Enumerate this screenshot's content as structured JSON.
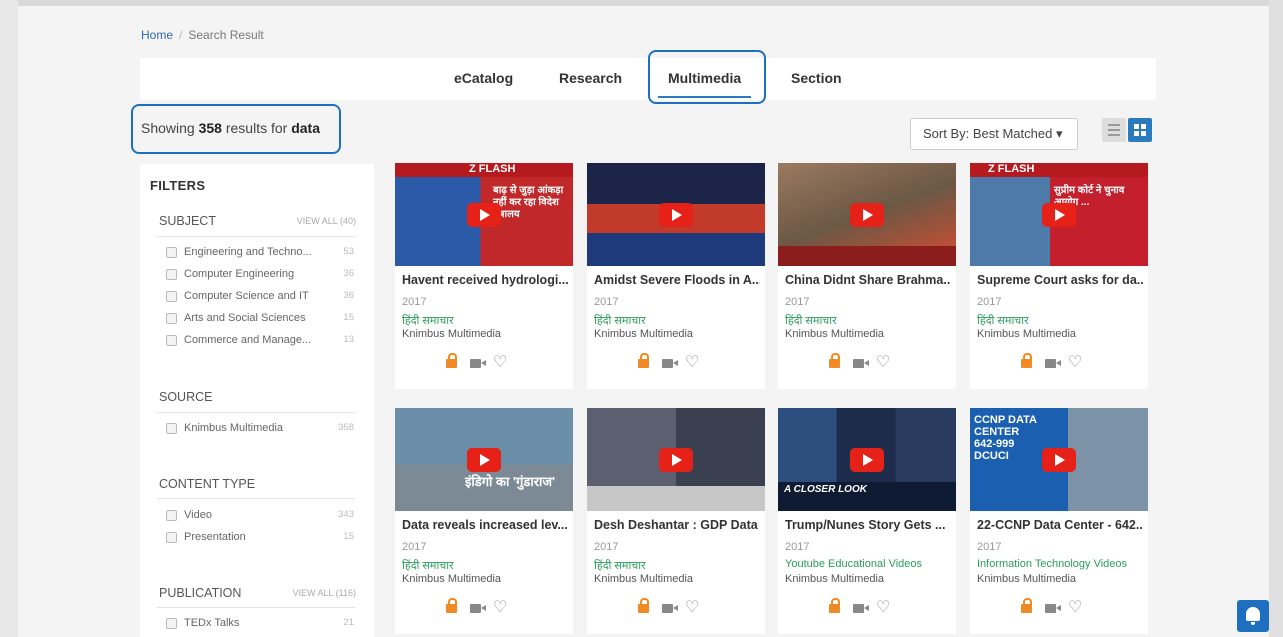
{
  "breadcrumb": {
    "home": "Home",
    "current": "Search Result",
    "separator": "/"
  },
  "tabs": [
    {
      "label": "eCatalog"
    },
    {
      "label": "Research"
    },
    {
      "label": "Multimedia",
      "active": true
    },
    {
      "label": "Section"
    }
  ],
  "results": {
    "prefix": "Showing",
    "count": "358",
    "middle": "results for",
    "query": "data"
  },
  "sort": {
    "label": "Sort By: Best Matched",
    "caret": "▾"
  },
  "filters": {
    "title": "FILTERS",
    "subject": {
      "title": "SUBJECT",
      "view_all": "VIEW ALL (40)",
      "items": [
        {
          "label": "Engineering and Techno...",
          "count": "53"
        },
        {
          "label": "Computer Engineering",
          "count": "36"
        },
        {
          "label": "Computer Science and IT",
          "count": "36"
        },
        {
          "label": "Arts and Social Sciences",
          "count": "15"
        },
        {
          "label": "Commerce and Manage...",
          "count": "13"
        }
      ]
    },
    "source": {
      "title": "SOURCE",
      "items": [
        {
          "label": "Knimbus Multimedia",
          "count": "358"
        }
      ]
    },
    "content_type": {
      "title": "CONTENT TYPE",
      "items": [
        {
          "label": "Video",
          "count": "343"
        },
        {
          "label": "Presentation",
          "count": "15"
        }
      ]
    },
    "publication": {
      "title": "PUBLICATION",
      "view_all": "VIEW ALL (116)",
      "items": [
        {
          "label": "TEDx Talks",
          "count": "21"
        }
      ]
    }
  },
  "cards": [
    {
      "title": "Havent received hydrologi...",
      "year": "2017",
      "category": "हिंदी समाचार",
      "publisher": "Knimbus Multimedia",
      "thumb_text": "बाढ़ से जुड़ा आंकड़ा नहीं कर रहा विदेश मंत्रालय",
      "thumb_badge": "Z FLASH"
    },
    {
      "title": "Amidst Severe Floods in A...",
      "year": "2017",
      "category": "हिंदी समाचार",
      "publisher": "Knimbus Multimedia",
      "thumb_text": "",
      "thumb_badge": ""
    },
    {
      "title": "China Didnt Share Brahma...",
      "year": "2017",
      "category": "हिंदी समाचार",
      "publisher": "Knimbus Multimedia",
      "thumb_text": "",
      "thumb_badge": ""
    },
    {
      "title": "Supreme Court asks for da...",
      "year": "2017",
      "category": "हिंदी समाचार",
      "publisher": "Knimbus Multimedia",
      "thumb_text": "सुप्रीम कोर्ट ने चुनाव आयोग ...",
      "thumb_badge": "Z FLASH"
    },
    {
      "title": "Data reveals increased lev...",
      "year": "2017",
      "category": "हिंदी समाचार",
      "publisher": "Knimbus Multimedia",
      "thumb_text": "इंडिगो का 'गुंडाराज'",
      "thumb_badge": ""
    },
    {
      "title": "Desh Deshantar : GDP Data",
      "year": "2017",
      "category": "हिंदी समाचार",
      "publisher": "Knimbus Multimedia",
      "thumb_text": "",
      "thumb_badge": ""
    },
    {
      "title": "Trump/Nunes Story Gets ...",
      "year": "2017",
      "category": "Youtube Educational Videos",
      "publisher": "Knimbus Multimedia",
      "thumb_text": "A CLOSER LOOK",
      "thumb_badge": ""
    },
    {
      "title": "22-CCNP Data Center - 642...",
      "year": "2017",
      "category": "Information Technology Videos",
      "publisher": "Knimbus Multimedia",
      "thumb_text": "CCNP DATA CENTER 642-999 DCUCI",
      "thumb_badge": ""
    }
  ],
  "colors": {
    "accent": "#2a7bbd",
    "highlight_border": "#1d6fc0",
    "category_green": "#2a9d5c",
    "lock_orange": "#f08a24"
  }
}
